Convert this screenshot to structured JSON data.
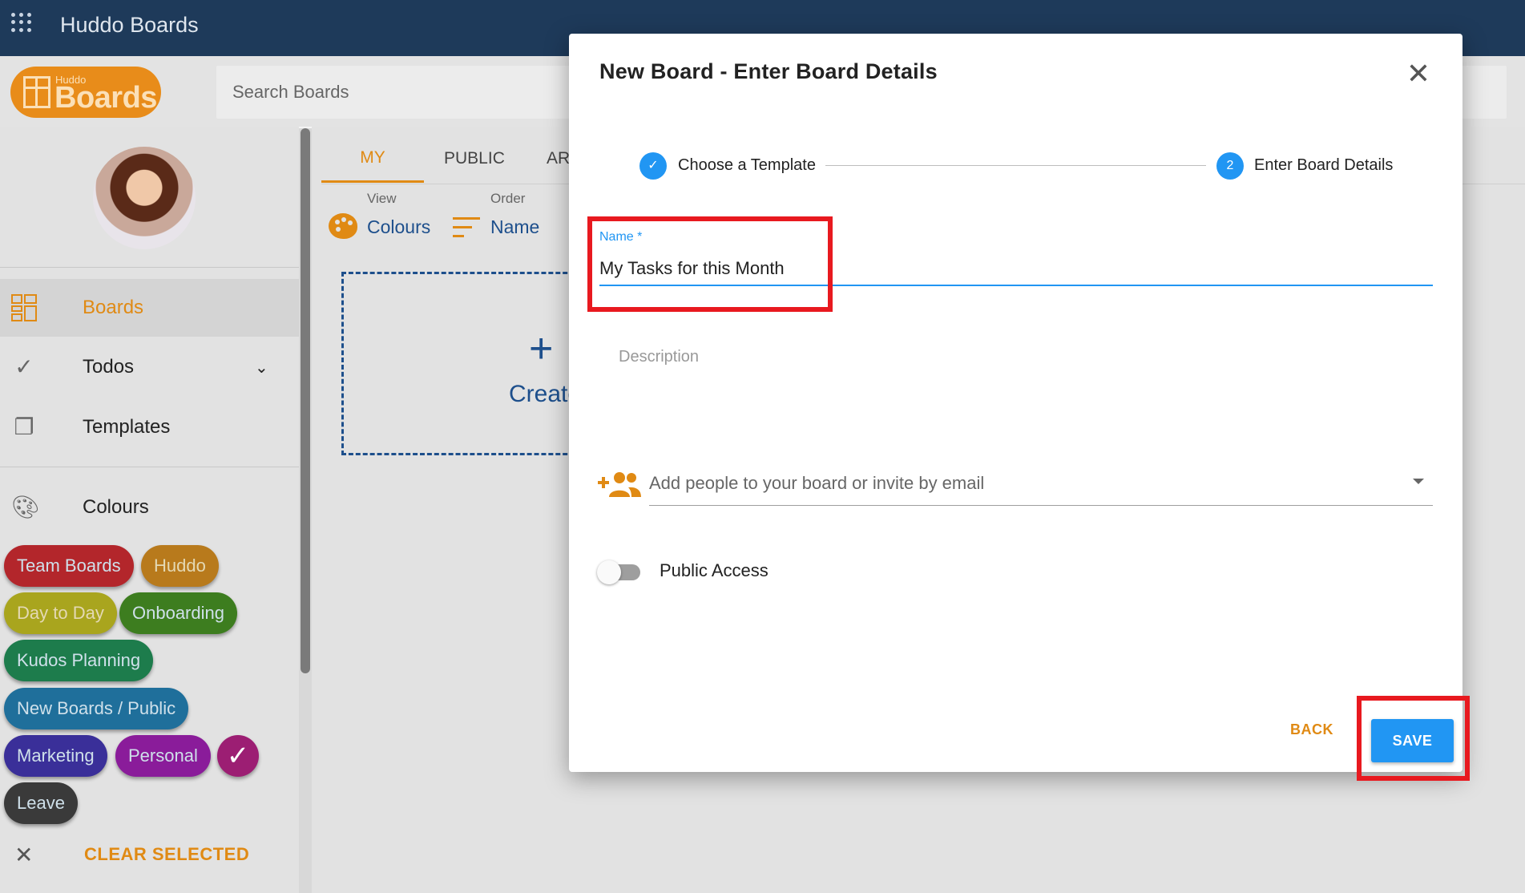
{
  "appbar": {
    "title": "Huddo Boards"
  },
  "logo": {
    "small": "Huddo",
    "big": "Boards"
  },
  "search": {
    "placeholder": "Search Boards"
  },
  "sidebar": {
    "nav": [
      {
        "label": "Boards"
      },
      {
        "label": "Todos"
      },
      {
        "label": "Templates"
      },
      {
        "label": "Colours"
      }
    ],
    "chips": [
      {
        "label": "Team Boards",
        "color": "#b3262b"
      },
      {
        "label": "Huddo",
        "color": "#b87a1c"
      },
      {
        "label": "Day to Day",
        "color": "#a9a51e"
      },
      {
        "label": "Onboarding",
        "color": "#3d7d1f"
      },
      {
        "label": "Kudos Planning",
        "color": "#1d7c4c"
      },
      {
        "label": "New Boards / Public",
        "color": "#1f6f9b"
      },
      {
        "label": "Marketing",
        "color": "#3a2f99"
      },
      {
        "label": "Personal",
        "color": "#8a1c9a"
      },
      {
        "label": "Leave",
        "color": "#3a3a3a"
      }
    ],
    "clear_label": "CLEAR SELECTED"
  },
  "main": {
    "tabs": [
      {
        "label": "MY"
      },
      {
        "label": "PUBLIC"
      },
      {
        "label": "AR"
      }
    ],
    "view": {
      "caption": "View",
      "value": "Colours"
    },
    "order": {
      "caption": "Order",
      "value": "Name"
    },
    "create_label": "Create"
  },
  "dialog": {
    "title": "New Board - Enter Board Details",
    "steps": [
      {
        "label": "Choose a Template",
        "state": "done"
      },
      {
        "number": "2",
        "label": "Enter Board Details",
        "state": "active"
      }
    ],
    "name_label": "Name *",
    "name_value": "My Tasks for this Month",
    "description_placeholder": "Description",
    "people_placeholder": "Add people to your board or invite by email",
    "public_access_label": "Public Access",
    "back_label": "BACK",
    "save_label": "SAVE"
  },
  "colors": {
    "accent": "#e08a14",
    "primary": "#2196f3",
    "appbar": "#1e3a5a",
    "highlight": "#e8191f"
  }
}
